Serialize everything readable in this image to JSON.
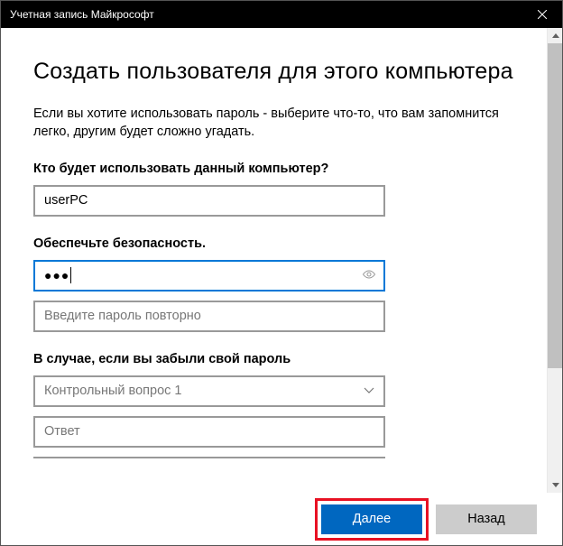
{
  "titlebar": {
    "title": "Учетная запись Майкрософт"
  },
  "heading": "Создать пользователя для этого компьютера",
  "description": "Если вы хотите использовать пароль - выберите что-то, что вам запомнится легко, другим будет сложно угадать.",
  "username": {
    "label": "Кто будет использовать данный компьютер?",
    "value": "userPC"
  },
  "security": {
    "label": "Обеспечьте безопасность.",
    "password_display": "●●●",
    "confirm_placeholder": "Введите пароль повторно"
  },
  "forgot": {
    "label": "В случае, если вы забыли свой пароль",
    "question_placeholder": "Контрольный вопрос 1",
    "answer_placeholder": "Ответ"
  },
  "buttons": {
    "next": "Далее",
    "back": "Назад"
  }
}
